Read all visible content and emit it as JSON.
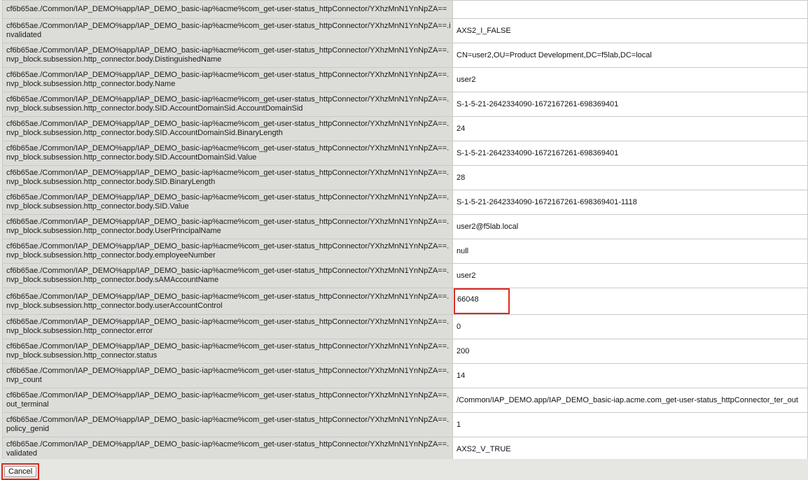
{
  "session_variables": {
    "rows": [
      {
        "key": "cf6b65ae./Common/IAP_DEMO%app/IAP_DEMO_basic-iap%acme%com_get-user-status_httpConnector/YXhzMnN1YnNpZA==",
        "value": "",
        "highlighted": false
      },
      {
        "key": "cf6b65ae./Common/IAP_DEMO%app/IAP_DEMO_basic-iap%acme%com_get-user-status_httpConnector/YXhzMnN1YnNpZA==.invalidated",
        "value": "AXS2_I_FALSE",
        "highlighted": false
      },
      {
        "key": "cf6b65ae./Common/IAP_DEMO%app/IAP_DEMO_basic-iap%acme%com_get-user-status_httpConnector/YXhzMnN1YnNpZA==.nvp_block.subsession.http_connector.body.DistinguishedName",
        "value": "CN=user2,OU=Product Development,DC=f5lab,DC=local",
        "highlighted": false
      },
      {
        "key": "cf6b65ae./Common/IAP_DEMO%app/IAP_DEMO_basic-iap%acme%com_get-user-status_httpConnector/YXhzMnN1YnNpZA==.nvp_block.subsession.http_connector.body.Name",
        "value": "user2",
        "highlighted": false
      },
      {
        "key": "cf6b65ae./Common/IAP_DEMO%app/IAP_DEMO_basic-iap%acme%com_get-user-status_httpConnector/YXhzMnN1YnNpZA==.nvp_block.subsession.http_connector.body.SID.AccountDomainSid.AccountDomainSid",
        "value": "S-1-5-21-2642334090-1672167261-698369401",
        "highlighted": false
      },
      {
        "key": "cf6b65ae./Common/IAP_DEMO%app/IAP_DEMO_basic-iap%acme%com_get-user-status_httpConnector/YXhzMnN1YnNpZA==.nvp_block.subsession.http_connector.body.SID.AccountDomainSid.BinaryLength",
        "value": "24",
        "highlighted": false
      },
      {
        "key": "cf6b65ae./Common/IAP_DEMO%app/IAP_DEMO_basic-iap%acme%com_get-user-status_httpConnector/YXhzMnN1YnNpZA==.nvp_block.subsession.http_connector.body.SID.AccountDomainSid.Value",
        "value": "S-1-5-21-2642334090-1672167261-698369401",
        "highlighted": false
      },
      {
        "key": "cf6b65ae./Common/IAP_DEMO%app/IAP_DEMO_basic-iap%acme%com_get-user-status_httpConnector/YXhzMnN1YnNpZA==.nvp_block.subsession.http_connector.body.SID.BinaryLength",
        "value": "28",
        "highlighted": false
      },
      {
        "key": "cf6b65ae./Common/IAP_DEMO%app/IAP_DEMO_basic-iap%acme%com_get-user-status_httpConnector/YXhzMnN1YnNpZA==.nvp_block.subsession.http_connector.body.SID.Value",
        "value": "S-1-5-21-2642334090-1672167261-698369401-1118",
        "highlighted": false
      },
      {
        "key": "cf6b65ae./Common/IAP_DEMO%app/IAP_DEMO_basic-iap%acme%com_get-user-status_httpConnector/YXhzMnN1YnNpZA==.nvp_block.subsession.http_connector.body.UserPrincipalName",
        "value": "user2@f5lab.local",
        "highlighted": false
      },
      {
        "key": "cf6b65ae./Common/IAP_DEMO%app/IAP_DEMO_basic-iap%acme%com_get-user-status_httpConnector/YXhzMnN1YnNpZA==.nvp_block.subsession.http_connector.body.employeeNumber",
        "value": "null",
        "highlighted": false
      },
      {
        "key": "cf6b65ae./Common/IAP_DEMO%app/IAP_DEMO_basic-iap%acme%com_get-user-status_httpConnector/YXhzMnN1YnNpZA==.nvp_block.subsession.http_connector.body.sAMAccountName",
        "value": "user2",
        "highlighted": false
      },
      {
        "key": "cf6b65ae./Common/IAP_DEMO%app/IAP_DEMO_basic-iap%acme%com_get-user-status_httpConnector/YXhzMnN1YnNpZA==.nvp_block.subsession.http_connector.body.userAccountControl",
        "value": "66048",
        "highlighted": true
      },
      {
        "key": "cf6b65ae./Common/IAP_DEMO%app/IAP_DEMO_basic-iap%acme%com_get-user-status_httpConnector/YXhzMnN1YnNpZA==.nvp_block.subsession.http_connector.error",
        "value": "0",
        "highlighted": false
      },
      {
        "key": "cf6b65ae./Common/IAP_DEMO%app/IAP_DEMO_basic-iap%acme%com_get-user-status_httpConnector/YXhzMnN1YnNpZA==.nvp_block.subsession.http_connector.status",
        "value": "200",
        "highlighted": false
      },
      {
        "key": "cf6b65ae./Common/IAP_DEMO%app/IAP_DEMO_basic-iap%acme%com_get-user-status_httpConnector/YXhzMnN1YnNpZA==.nvp_count",
        "value": "14",
        "highlighted": false
      },
      {
        "key": "cf6b65ae./Common/IAP_DEMO%app/IAP_DEMO_basic-iap%acme%com_get-user-status_httpConnector/YXhzMnN1YnNpZA==.out_terminal",
        "value": "/Common/IAP_DEMO.app/IAP_DEMO_basic-iap.acme.com_get-user-status_httpConnector_ter_out",
        "highlighted": false
      },
      {
        "key": "cf6b65ae./Common/IAP_DEMO%app/IAP_DEMO_basic-iap%acme%com_get-user-status_httpConnector/YXhzMnN1YnNpZA==.policy_genid",
        "value": "1",
        "highlighted": false
      },
      {
        "key": "cf6b65ae./Common/IAP_DEMO%app/IAP_DEMO_basic-iap%acme%com_get-user-status_httpConnector/YXhzMnN1YnNpZA==.validated",
        "value": "AXS2_V_TRUE",
        "highlighted": false
      }
    ]
  },
  "footer": {
    "cancel_label": "Cancel"
  },
  "colors": {
    "highlight": "#e0281e",
    "key_cell_bg": "#dcdcd9",
    "value_cell_bg": "#ffffff"
  }
}
